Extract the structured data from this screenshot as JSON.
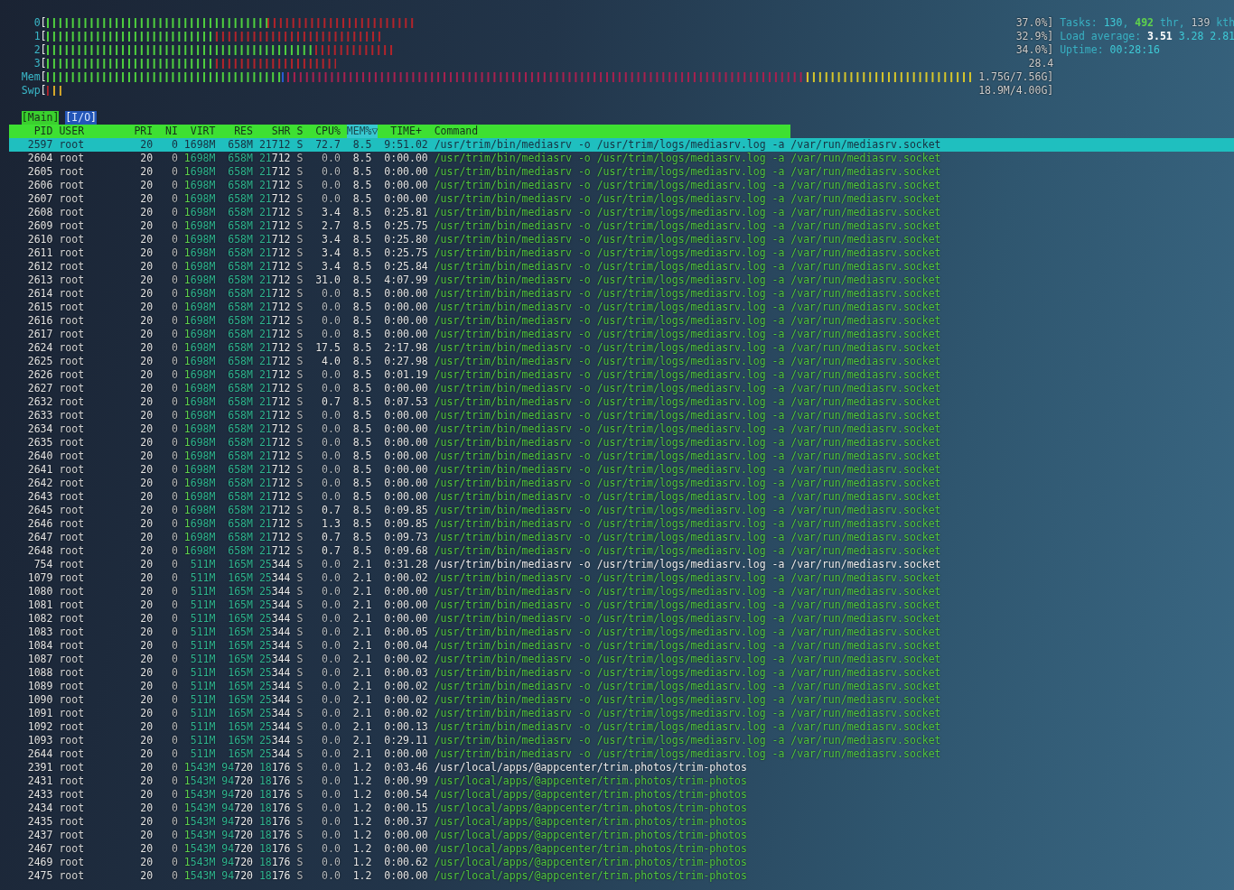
{
  "meters": [
    {
      "label": "0",
      "open": "[",
      "value": "37.0%]"
    },
    {
      "label": "1",
      "open": "[",
      "value": "32.9%]"
    },
    {
      "label": "2",
      "open": "[",
      "value": "34.0%]"
    },
    {
      "label": "3",
      "open": "[",
      "value": "28.4"
    },
    {
      "label": "Mem",
      "open": "[",
      "value": "1.75G/7.56G]"
    },
    {
      "label": "Swp",
      "open": "[",
      "value": "18.9M/4.00G]"
    }
  ],
  "info": [
    [
      {
        "text": "Tasks: ",
        "kind": "label"
      },
      {
        "text": "130",
        "kind": "value"
      },
      {
        "text": ", ",
        "kind": "label"
      },
      {
        "text": "492",
        "kind": "running"
      },
      {
        "text": " thr, ",
        "kind": "label"
      },
      {
        "text": "139",
        "kind": "muted"
      },
      {
        "text": " kth",
        "kind": "label"
      }
    ],
    [
      {
        "text": "Load average: ",
        "kind": "label"
      },
      {
        "text": "3.51",
        "kind": "bold"
      },
      {
        "text": " 3.28 2.81",
        "kind": "value"
      }
    ],
    [
      {
        "text": "Uptime: ",
        "kind": "label"
      },
      {
        "text": "00:28:16",
        "kind": "value"
      }
    ]
  ],
  "tabs": [
    {
      "open": "[",
      "label": "Main",
      "close": "]",
      "selected": true
    },
    {
      "open": "[",
      "label": "I/O",
      "close": "]",
      "selected": false
    }
  ],
  "table": {
    "sort_indicator": "▽",
    "columns": [
      {
        "label": "PID",
        "sorted": false
      },
      {
        "label": "USER",
        "sorted": false
      },
      {
        "label": "PRI",
        "sorted": false
      },
      {
        "label": "NI",
        "sorted": false
      },
      {
        "label": "VIRT",
        "sorted": false
      },
      {
        "label": "RES",
        "sorted": false
      },
      {
        "label": "SHR",
        "sorted": false
      },
      {
        "label": "S",
        "sorted": false
      },
      {
        "label": "CPU%",
        "sorted": false
      },
      {
        "label": "MEM%",
        "sorted": true
      },
      {
        "label": "TIME+",
        "sorted": false
      },
      {
        "label": "Command",
        "sorted": false
      }
    ],
    "rows": [
      {
        "pid": "2597",
        "user": "root",
        "pri": "20",
        "ni": "0",
        "virt": "1698M",
        "res": "658M",
        "shr": "21712",
        "s": "S",
        "cpu": "72.7",
        "mem": "8.5",
        "time": "9:51.02",
        "command": "/usr/trim/bin/mediasrv -o /usr/trim/logs/mediasrv.log -a /var/run/mediasrv.socket",
        "thread": false,
        "selected": true
      },
      {
        "pid": "2604",
        "user": "root",
        "pri": "20",
        "ni": "0",
        "virt": "1698M",
        "res": "658M",
        "shr": "21712",
        "s": "S",
        "cpu": "0.0",
        "mem": "8.5",
        "time": "0:00.00",
        "command": "/usr/trim/bin/mediasrv -o /usr/trim/logs/mediasrv.log -a /var/run/mediasrv.socket",
        "thread": true,
        "selected": false
      },
      {
        "pid": "2605",
        "user": "root",
        "pri": "20",
        "ni": "0",
        "virt": "1698M",
        "res": "658M",
        "shr": "21712",
        "s": "S",
        "cpu": "0.0",
        "mem": "8.5",
        "time": "0:00.00",
        "command": "/usr/trim/bin/mediasrv -o /usr/trim/logs/mediasrv.log -a /var/run/mediasrv.socket",
        "thread": true,
        "selected": false
      },
      {
        "pid": "2606",
        "user": "root",
        "pri": "20",
        "ni": "0",
        "virt": "1698M",
        "res": "658M",
        "shr": "21712",
        "s": "S",
        "cpu": "0.0",
        "mem": "8.5",
        "time": "0:00.00",
        "command": "/usr/trim/bin/mediasrv -o /usr/trim/logs/mediasrv.log -a /var/run/mediasrv.socket",
        "thread": true,
        "selected": false
      },
      {
        "pid": "2607",
        "user": "root",
        "pri": "20",
        "ni": "0",
        "virt": "1698M",
        "res": "658M",
        "shr": "21712",
        "s": "S",
        "cpu": "0.0",
        "mem": "8.5",
        "time": "0:00.00",
        "command": "/usr/trim/bin/mediasrv -o /usr/trim/logs/mediasrv.log -a /var/run/mediasrv.socket",
        "thread": true,
        "selected": false
      },
      {
        "pid": "2608",
        "user": "root",
        "pri": "20",
        "ni": "0",
        "virt": "1698M",
        "res": "658M",
        "shr": "21712",
        "s": "S",
        "cpu": "3.4",
        "mem": "8.5",
        "time": "0:25.81",
        "command": "/usr/trim/bin/mediasrv -o /usr/trim/logs/mediasrv.log -a /var/run/mediasrv.socket",
        "thread": true,
        "selected": false
      },
      {
        "pid": "2609",
        "user": "root",
        "pri": "20",
        "ni": "0",
        "virt": "1698M",
        "res": "658M",
        "shr": "21712",
        "s": "S",
        "cpu": "2.7",
        "mem": "8.5",
        "time": "0:25.75",
        "command": "/usr/trim/bin/mediasrv -o /usr/trim/logs/mediasrv.log -a /var/run/mediasrv.socket",
        "thread": true,
        "selected": false
      },
      {
        "pid": "2610",
        "user": "root",
        "pri": "20",
        "ni": "0",
        "virt": "1698M",
        "res": "658M",
        "shr": "21712",
        "s": "S",
        "cpu": "3.4",
        "mem": "8.5",
        "time": "0:25.80",
        "command": "/usr/trim/bin/mediasrv -o /usr/trim/logs/mediasrv.log -a /var/run/mediasrv.socket",
        "thread": true,
        "selected": false
      },
      {
        "pid": "2611",
        "user": "root",
        "pri": "20",
        "ni": "0",
        "virt": "1698M",
        "res": "658M",
        "shr": "21712",
        "s": "S",
        "cpu": "3.4",
        "mem": "8.5",
        "time": "0:25.75",
        "command": "/usr/trim/bin/mediasrv -o /usr/trim/logs/mediasrv.log -a /var/run/mediasrv.socket",
        "thread": true,
        "selected": false
      },
      {
        "pid": "2612",
        "user": "root",
        "pri": "20",
        "ni": "0",
        "virt": "1698M",
        "res": "658M",
        "shr": "21712",
        "s": "S",
        "cpu": "3.4",
        "mem": "8.5",
        "time": "0:25.84",
        "command": "/usr/trim/bin/mediasrv -o /usr/trim/logs/mediasrv.log -a /var/run/mediasrv.socket",
        "thread": true,
        "selected": false
      },
      {
        "pid": "2613",
        "user": "root",
        "pri": "20",
        "ni": "0",
        "virt": "1698M",
        "res": "658M",
        "shr": "21712",
        "s": "S",
        "cpu": "31.0",
        "mem": "8.5",
        "time": "4:07.99",
        "command": "/usr/trim/bin/mediasrv -o /usr/trim/logs/mediasrv.log -a /var/run/mediasrv.socket",
        "thread": true,
        "selected": false
      },
      {
        "pid": "2614",
        "user": "root",
        "pri": "20",
        "ni": "0",
        "virt": "1698M",
        "res": "658M",
        "shr": "21712",
        "s": "S",
        "cpu": "0.0",
        "mem": "8.5",
        "time": "0:00.00",
        "command": "/usr/trim/bin/mediasrv -o /usr/trim/logs/mediasrv.log -a /var/run/mediasrv.socket",
        "thread": true,
        "selected": false
      },
      {
        "pid": "2615",
        "user": "root",
        "pri": "20",
        "ni": "0",
        "virt": "1698M",
        "res": "658M",
        "shr": "21712",
        "s": "S",
        "cpu": "0.0",
        "mem": "8.5",
        "time": "0:00.00",
        "command": "/usr/trim/bin/mediasrv -o /usr/trim/logs/mediasrv.log -a /var/run/mediasrv.socket",
        "thread": true,
        "selected": false
      },
      {
        "pid": "2616",
        "user": "root",
        "pri": "20",
        "ni": "0",
        "virt": "1698M",
        "res": "658M",
        "shr": "21712",
        "s": "S",
        "cpu": "0.0",
        "mem": "8.5",
        "time": "0:00.00",
        "command": "/usr/trim/bin/mediasrv -o /usr/trim/logs/mediasrv.log -a /var/run/mediasrv.socket",
        "thread": true,
        "selected": false
      },
      {
        "pid": "2617",
        "user": "root",
        "pri": "20",
        "ni": "0",
        "virt": "1698M",
        "res": "658M",
        "shr": "21712",
        "s": "S",
        "cpu": "0.0",
        "mem": "8.5",
        "time": "0:00.00",
        "command": "/usr/trim/bin/mediasrv -o /usr/trim/logs/mediasrv.log -a /var/run/mediasrv.socket",
        "thread": true,
        "selected": false
      },
      {
        "pid": "2624",
        "user": "root",
        "pri": "20",
        "ni": "0",
        "virt": "1698M",
        "res": "658M",
        "shr": "21712",
        "s": "S",
        "cpu": "17.5",
        "mem": "8.5",
        "time": "2:17.98",
        "command": "/usr/trim/bin/mediasrv -o /usr/trim/logs/mediasrv.log -a /var/run/mediasrv.socket",
        "thread": true,
        "selected": false
      },
      {
        "pid": "2625",
        "user": "root",
        "pri": "20",
        "ni": "0",
        "virt": "1698M",
        "res": "658M",
        "shr": "21712",
        "s": "S",
        "cpu": "4.0",
        "mem": "8.5",
        "time": "0:27.98",
        "command": "/usr/trim/bin/mediasrv -o /usr/trim/logs/mediasrv.log -a /var/run/mediasrv.socket",
        "thread": true,
        "selected": false
      },
      {
        "pid": "2626",
        "user": "root",
        "pri": "20",
        "ni": "0",
        "virt": "1698M",
        "res": "658M",
        "shr": "21712",
        "s": "S",
        "cpu": "0.0",
        "mem": "8.5",
        "time": "0:01.19",
        "command": "/usr/trim/bin/mediasrv -o /usr/trim/logs/mediasrv.log -a /var/run/mediasrv.socket",
        "thread": true,
        "selected": false
      },
      {
        "pid": "2627",
        "user": "root",
        "pri": "20",
        "ni": "0",
        "virt": "1698M",
        "res": "658M",
        "shr": "21712",
        "s": "S",
        "cpu": "0.0",
        "mem": "8.5",
        "time": "0:00.00",
        "command": "/usr/trim/bin/mediasrv -o /usr/trim/logs/mediasrv.log -a /var/run/mediasrv.socket",
        "thread": true,
        "selected": false
      },
      {
        "pid": "2632",
        "user": "root",
        "pri": "20",
        "ni": "0",
        "virt": "1698M",
        "res": "658M",
        "shr": "21712",
        "s": "S",
        "cpu": "0.7",
        "mem": "8.5",
        "time": "0:07.53",
        "command": "/usr/trim/bin/mediasrv -o /usr/trim/logs/mediasrv.log -a /var/run/mediasrv.socket",
        "thread": true,
        "selected": false
      },
      {
        "pid": "2633",
        "user": "root",
        "pri": "20",
        "ni": "0",
        "virt": "1698M",
        "res": "658M",
        "shr": "21712",
        "s": "S",
        "cpu": "0.0",
        "mem": "8.5",
        "time": "0:00.00",
        "command": "/usr/trim/bin/mediasrv -o /usr/trim/logs/mediasrv.log -a /var/run/mediasrv.socket",
        "thread": true,
        "selected": false
      },
      {
        "pid": "2634",
        "user": "root",
        "pri": "20",
        "ni": "0",
        "virt": "1698M",
        "res": "658M",
        "shr": "21712",
        "s": "S",
        "cpu": "0.0",
        "mem": "8.5",
        "time": "0:00.00",
        "command": "/usr/trim/bin/mediasrv -o /usr/trim/logs/mediasrv.log -a /var/run/mediasrv.socket",
        "thread": true,
        "selected": false
      },
      {
        "pid": "2635",
        "user": "root",
        "pri": "20",
        "ni": "0",
        "virt": "1698M",
        "res": "658M",
        "shr": "21712",
        "s": "S",
        "cpu": "0.0",
        "mem": "8.5",
        "time": "0:00.00",
        "command": "/usr/trim/bin/mediasrv -o /usr/trim/logs/mediasrv.log -a /var/run/mediasrv.socket",
        "thread": true,
        "selected": false
      },
      {
        "pid": "2640",
        "user": "root",
        "pri": "20",
        "ni": "0",
        "virt": "1698M",
        "res": "658M",
        "shr": "21712",
        "s": "S",
        "cpu": "0.0",
        "mem": "8.5",
        "time": "0:00.00",
        "command": "/usr/trim/bin/mediasrv -o /usr/trim/logs/mediasrv.log -a /var/run/mediasrv.socket",
        "thread": true,
        "selected": false
      },
      {
        "pid": "2641",
        "user": "root",
        "pri": "20",
        "ni": "0",
        "virt": "1698M",
        "res": "658M",
        "shr": "21712",
        "s": "S",
        "cpu": "0.0",
        "mem": "8.5",
        "time": "0:00.00",
        "command": "/usr/trim/bin/mediasrv -o /usr/trim/logs/mediasrv.log -a /var/run/mediasrv.socket",
        "thread": true,
        "selected": false
      },
      {
        "pid": "2642",
        "user": "root",
        "pri": "20",
        "ni": "0",
        "virt": "1698M",
        "res": "658M",
        "shr": "21712",
        "s": "S",
        "cpu": "0.0",
        "mem": "8.5",
        "time": "0:00.00",
        "command": "/usr/trim/bin/mediasrv -o /usr/trim/logs/mediasrv.log -a /var/run/mediasrv.socket",
        "thread": true,
        "selected": false
      },
      {
        "pid": "2643",
        "user": "root",
        "pri": "20",
        "ni": "0",
        "virt": "1698M",
        "res": "658M",
        "shr": "21712",
        "s": "S",
        "cpu": "0.0",
        "mem": "8.5",
        "time": "0:00.00",
        "command": "/usr/trim/bin/mediasrv -o /usr/trim/logs/mediasrv.log -a /var/run/mediasrv.socket",
        "thread": true,
        "selected": false
      },
      {
        "pid": "2645",
        "user": "root",
        "pri": "20",
        "ni": "0",
        "virt": "1698M",
        "res": "658M",
        "shr": "21712",
        "s": "S",
        "cpu": "0.7",
        "mem": "8.5",
        "time": "0:09.85",
        "command": "/usr/trim/bin/mediasrv -o /usr/trim/logs/mediasrv.log -a /var/run/mediasrv.socket",
        "thread": true,
        "selected": false
      },
      {
        "pid": "2646",
        "user": "root",
        "pri": "20",
        "ni": "0",
        "virt": "1698M",
        "res": "658M",
        "shr": "21712",
        "s": "S",
        "cpu": "1.3",
        "mem": "8.5",
        "time": "0:09.85",
        "command": "/usr/trim/bin/mediasrv -o /usr/trim/logs/mediasrv.log -a /var/run/mediasrv.socket",
        "thread": true,
        "selected": false
      },
      {
        "pid": "2647",
        "user": "root",
        "pri": "20",
        "ni": "0",
        "virt": "1698M",
        "res": "658M",
        "shr": "21712",
        "s": "S",
        "cpu": "0.7",
        "mem": "8.5",
        "time": "0:09.73",
        "command": "/usr/trim/bin/mediasrv -o /usr/trim/logs/mediasrv.log -a /var/run/mediasrv.socket",
        "thread": true,
        "selected": false
      },
      {
        "pid": "2648",
        "user": "root",
        "pri": "20",
        "ni": "0",
        "virt": "1698M",
        "res": "658M",
        "shr": "21712",
        "s": "S",
        "cpu": "0.7",
        "mem": "8.5",
        "time": "0:09.68",
        "command": "/usr/trim/bin/mediasrv -o /usr/trim/logs/mediasrv.log -a /var/run/mediasrv.socket",
        "thread": true,
        "selected": false
      },
      {
        "pid": "754",
        "user": "root",
        "pri": "20",
        "ni": "0",
        "virt": "511M",
        "res": "165M",
        "shr": "25344",
        "s": "S",
        "cpu": "0.0",
        "mem": "2.1",
        "time": "0:31.28",
        "command": "/usr/trim/bin/mediasrv -o /usr/trim/logs/mediasrv.log -a /var/run/mediasrv.socket",
        "thread": false,
        "selected": false
      },
      {
        "pid": "1079",
        "user": "root",
        "pri": "20",
        "ni": "0",
        "virt": "511M",
        "res": "165M",
        "shr": "25344",
        "s": "S",
        "cpu": "0.0",
        "mem": "2.1",
        "time": "0:00.02",
        "command": "/usr/trim/bin/mediasrv -o /usr/trim/logs/mediasrv.log -a /var/run/mediasrv.socket",
        "thread": true,
        "selected": false
      },
      {
        "pid": "1080",
        "user": "root",
        "pri": "20",
        "ni": "0",
        "virt": "511M",
        "res": "165M",
        "shr": "25344",
        "s": "S",
        "cpu": "0.0",
        "mem": "2.1",
        "time": "0:00.00",
        "command": "/usr/trim/bin/mediasrv -o /usr/trim/logs/mediasrv.log -a /var/run/mediasrv.socket",
        "thread": true,
        "selected": false
      },
      {
        "pid": "1081",
        "user": "root",
        "pri": "20",
        "ni": "0",
        "virt": "511M",
        "res": "165M",
        "shr": "25344",
        "s": "S",
        "cpu": "0.0",
        "mem": "2.1",
        "time": "0:00.00",
        "command": "/usr/trim/bin/mediasrv -o /usr/trim/logs/mediasrv.log -a /var/run/mediasrv.socket",
        "thread": true,
        "selected": false
      },
      {
        "pid": "1082",
        "user": "root",
        "pri": "20",
        "ni": "0",
        "virt": "511M",
        "res": "165M",
        "shr": "25344",
        "s": "S",
        "cpu": "0.0",
        "mem": "2.1",
        "time": "0:00.00",
        "command": "/usr/trim/bin/mediasrv -o /usr/trim/logs/mediasrv.log -a /var/run/mediasrv.socket",
        "thread": true,
        "selected": false
      },
      {
        "pid": "1083",
        "user": "root",
        "pri": "20",
        "ni": "0",
        "virt": "511M",
        "res": "165M",
        "shr": "25344",
        "s": "S",
        "cpu": "0.0",
        "mem": "2.1",
        "time": "0:00.05",
        "command": "/usr/trim/bin/mediasrv -o /usr/trim/logs/mediasrv.log -a /var/run/mediasrv.socket",
        "thread": true,
        "selected": false
      },
      {
        "pid": "1084",
        "user": "root",
        "pri": "20",
        "ni": "0",
        "virt": "511M",
        "res": "165M",
        "shr": "25344",
        "s": "S",
        "cpu": "0.0",
        "mem": "2.1",
        "time": "0:00.04",
        "command": "/usr/trim/bin/mediasrv -o /usr/trim/logs/mediasrv.log -a /var/run/mediasrv.socket",
        "thread": true,
        "selected": false
      },
      {
        "pid": "1087",
        "user": "root",
        "pri": "20",
        "ni": "0",
        "virt": "511M",
        "res": "165M",
        "shr": "25344",
        "s": "S",
        "cpu": "0.0",
        "mem": "2.1",
        "time": "0:00.02",
        "command": "/usr/trim/bin/mediasrv -o /usr/trim/logs/mediasrv.log -a /var/run/mediasrv.socket",
        "thread": true,
        "selected": false
      },
      {
        "pid": "1088",
        "user": "root",
        "pri": "20",
        "ni": "0",
        "virt": "511M",
        "res": "165M",
        "shr": "25344",
        "s": "S",
        "cpu": "0.0",
        "mem": "2.1",
        "time": "0:00.03",
        "command": "/usr/trim/bin/mediasrv -o /usr/trim/logs/mediasrv.log -a /var/run/mediasrv.socket",
        "thread": true,
        "selected": false
      },
      {
        "pid": "1089",
        "user": "root",
        "pri": "20",
        "ni": "0",
        "virt": "511M",
        "res": "165M",
        "shr": "25344",
        "s": "S",
        "cpu": "0.0",
        "mem": "2.1",
        "time": "0:00.02",
        "command": "/usr/trim/bin/mediasrv -o /usr/trim/logs/mediasrv.log -a /var/run/mediasrv.socket",
        "thread": true,
        "selected": false
      },
      {
        "pid": "1090",
        "user": "root",
        "pri": "20",
        "ni": "0",
        "virt": "511M",
        "res": "165M",
        "shr": "25344",
        "s": "S",
        "cpu": "0.0",
        "mem": "2.1",
        "time": "0:00.02",
        "command": "/usr/trim/bin/mediasrv -o /usr/trim/logs/mediasrv.log -a /var/run/mediasrv.socket",
        "thread": true,
        "selected": false
      },
      {
        "pid": "1091",
        "user": "root",
        "pri": "20",
        "ni": "0",
        "virt": "511M",
        "res": "165M",
        "shr": "25344",
        "s": "S",
        "cpu": "0.0",
        "mem": "2.1",
        "time": "0:00.02",
        "command": "/usr/trim/bin/mediasrv -o /usr/trim/logs/mediasrv.log -a /var/run/mediasrv.socket",
        "thread": true,
        "selected": false
      },
      {
        "pid": "1092",
        "user": "root",
        "pri": "20",
        "ni": "0",
        "virt": "511M",
        "res": "165M",
        "shr": "25344",
        "s": "S",
        "cpu": "0.0",
        "mem": "2.1",
        "time": "0:00.13",
        "command": "/usr/trim/bin/mediasrv -o /usr/trim/logs/mediasrv.log -a /var/run/mediasrv.socket",
        "thread": true,
        "selected": false
      },
      {
        "pid": "1093",
        "user": "root",
        "pri": "20",
        "ni": "0",
        "virt": "511M",
        "res": "165M",
        "shr": "25344",
        "s": "S",
        "cpu": "0.0",
        "mem": "2.1",
        "time": "0:29.11",
        "command": "/usr/trim/bin/mediasrv -o /usr/trim/logs/mediasrv.log -a /var/run/mediasrv.socket",
        "thread": true,
        "selected": false
      },
      {
        "pid": "2644",
        "user": "root",
        "pri": "20",
        "ni": "0",
        "virt": "511M",
        "res": "165M",
        "shr": "25344",
        "s": "S",
        "cpu": "0.0",
        "mem": "2.1",
        "time": "0:00.00",
        "command": "/usr/trim/bin/mediasrv -o /usr/trim/logs/mediasrv.log -a /var/run/mediasrv.socket",
        "thread": true,
        "selected": false
      },
      {
        "pid": "2391",
        "user": "root",
        "pri": "20",
        "ni": "0",
        "virt": "1543M",
        "res": "94720",
        "shr": "18176",
        "s": "S",
        "cpu": "0.0",
        "mem": "1.2",
        "time": "0:03.46",
        "command": "/usr/local/apps/@appcenter/trim.photos/trim-photos",
        "thread": false,
        "selected": false
      },
      {
        "pid": "2431",
        "user": "root",
        "pri": "20",
        "ni": "0",
        "virt": "1543M",
        "res": "94720",
        "shr": "18176",
        "s": "S",
        "cpu": "0.0",
        "mem": "1.2",
        "time": "0:00.99",
        "command": "/usr/local/apps/@appcenter/trim.photos/trim-photos",
        "thread": true,
        "selected": false
      },
      {
        "pid": "2433",
        "user": "root",
        "pri": "20",
        "ni": "0",
        "virt": "1543M",
        "res": "94720",
        "shr": "18176",
        "s": "S",
        "cpu": "0.0",
        "mem": "1.2",
        "time": "0:00.54",
        "command": "/usr/local/apps/@appcenter/trim.photos/trim-photos",
        "thread": true,
        "selected": false
      },
      {
        "pid": "2434",
        "user": "root",
        "pri": "20",
        "ni": "0",
        "virt": "1543M",
        "res": "94720",
        "shr": "18176",
        "s": "S",
        "cpu": "0.0",
        "mem": "1.2",
        "time": "0:00.15",
        "command": "/usr/local/apps/@appcenter/trim.photos/trim-photos",
        "thread": true,
        "selected": false
      },
      {
        "pid": "2435",
        "user": "root",
        "pri": "20",
        "ni": "0",
        "virt": "1543M",
        "res": "94720",
        "shr": "18176",
        "s": "S",
        "cpu": "0.0",
        "mem": "1.2",
        "time": "0:00.37",
        "command": "/usr/local/apps/@appcenter/trim.photos/trim-photos",
        "thread": true,
        "selected": false
      },
      {
        "pid": "2437",
        "user": "root",
        "pri": "20",
        "ni": "0",
        "virt": "1543M",
        "res": "94720",
        "shr": "18176",
        "s": "S",
        "cpu": "0.0",
        "mem": "1.2",
        "time": "0:00.00",
        "command": "/usr/local/apps/@appcenter/trim.photos/trim-photos",
        "thread": true,
        "selected": false
      },
      {
        "pid": "2467",
        "user": "root",
        "pri": "20",
        "ni": "0",
        "virt": "1543M",
        "res": "94720",
        "shr": "18176",
        "s": "S",
        "cpu": "0.0",
        "mem": "1.2",
        "time": "0:00.00",
        "command": "/usr/local/apps/@appcenter/trim.photos/trim-photos",
        "thread": true,
        "selected": false
      },
      {
        "pid": "2469",
        "user": "root",
        "pri": "20",
        "ni": "0",
        "virt": "1543M",
        "res": "94720",
        "shr": "18176",
        "s": "S",
        "cpu": "0.0",
        "mem": "1.2",
        "time": "0:00.62",
        "command": "/usr/local/apps/@appcenter/trim.photos/trim-photos",
        "thread": true,
        "selected": false
      },
      {
        "pid": "2475",
        "user": "root",
        "pri": "20",
        "ni": "0",
        "virt": "1543M",
        "res": "94720",
        "shr": "18176",
        "s": "S",
        "cpu": "0.0",
        "mem": "1.2",
        "time": "0:00.00",
        "command": "/usr/local/apps/@appcenter/trim.photos/trim-photos",
        "thread": true,
        "selected": false
      }
    ]
  }
}
